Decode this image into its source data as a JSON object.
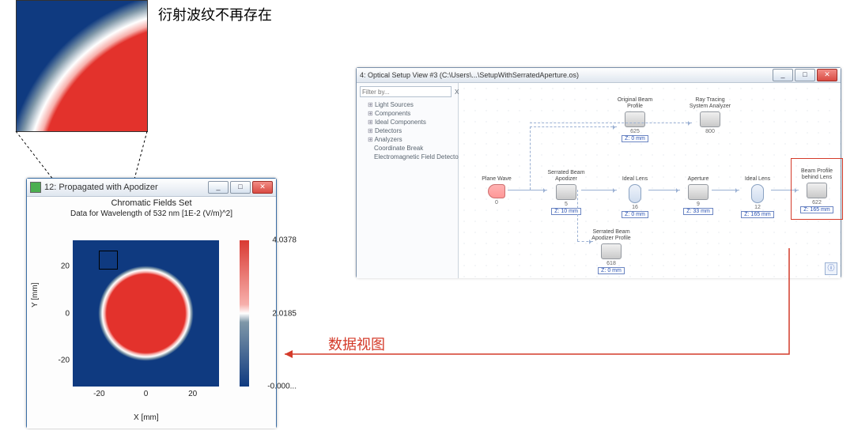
{
  "zoom": {
    "title": "衍射波纹不再存在"
  },
  "chart": {
    "win_title": "12: Propagated with Apodizer",
    "subtitle": "Chromatic Fields Set",
    "info": "Data for Wavelength of 532 nm   [1E-2 (V/m)^2]",
    "xlabel": "X [mm]",
    "ylabel": "Y [mm]",
    "y_ticks": [
      "20",
      "0",
      "-20"
    ],
    "x_ticks": [
      "-20",
      "0",
      "20"
    ],
    "cbar_ticks": [
      "4.0378",
      "2.0185",
      "-0.000..."
    ],
    "min_label": "_",
    "max_label": "□",
    "close_label": "✕"
  },
  "setup": {
    "win_title": "4: Optical Setup View #3 (C:\\Users\\...\\SetupWithSerratedAperture.os)",
    "filter_placeholder": "Filter by...",
    "go": "X",
    "tree": {
      "a": "Light Sources",
      "b": "Components",
      "c": "Ideal Components",
      "d": "Detectors",
      "e": "Analyzers",
      "f": "Coordinate Break",
      "g": "Electromagnetic Field Detector"
    },
    "nodes": {
      "plane": {
        "label": "Plane Wave",
        "id": "0"
      },
      "orig": {
        "label": "Original Beam Profile",
        "id": "625",
        "val": "Z: 0 mm"
      },
      "ray": {
        "label": "Ray Tracing System Analyzer",
        "id": "800"
      },
      "apod": {
        "label": "Serrated Beam Apodizer",
        "id": "5",
        "val": "Z: 10 mm"
      },
      "apodp": {
        "label": "Serrated Beam Apodizer Profile",
        "id": "618",
        "val": "Z: 0 mm"
      },
      "lens1": {
        "label": "Ideal Lens",
        "id": "16",
        "val": "Z: 0 mm"
      },
      "apert": {
        "label": "Aperture",
        "id": "9",
        "val": "Z: 33 mm"
      },
      "lens2": {
        "label": "Ideal Lens",
        "id": "12",
        "val": "Z: 165 mm"
      },
      "result": {
        "label": "Beam Profile behind Lens",
        "id": "622",
        "val": "Z: 165 mm"
      }
    },
    "panel_btn": "ⓘ"
  },
  "arrow_label": "数据视图",
  "chart_data": {
    "type": "heatmap",
    "title": "Chromatic Fields Set — Data for Wavelength of 532 nm [1E-2 (V/m)^2]",
    "xlabel": "X [mm]",
    "ylabel": "Y [mm]",
    "xlim": [
      -30,
      30
    ],
    "ylim": [
      -30,
      30
    ],
    "colorbar_range": [
      0.0,
      4.0378
    ],
    "description": "Radially symmetric apodized beam intensity. Flat-top ~4.0 inside radius ≈23 mm, smooth roll-off to 0 between r≈23 mm and r≈28 mm, 0 outside. No diffraction ripples present.",
    "radial_profile": {
      "r_mm": [
        0,
        10,
        20,
        22,
        24,
        26,
        28,
        30
      ],
      "intensity": [
        4.04,
        4.04,
        4.04,
        4.0,
        2.5,
        0.7,
        0.0,
        0.0
      ]
    }
  }
}
